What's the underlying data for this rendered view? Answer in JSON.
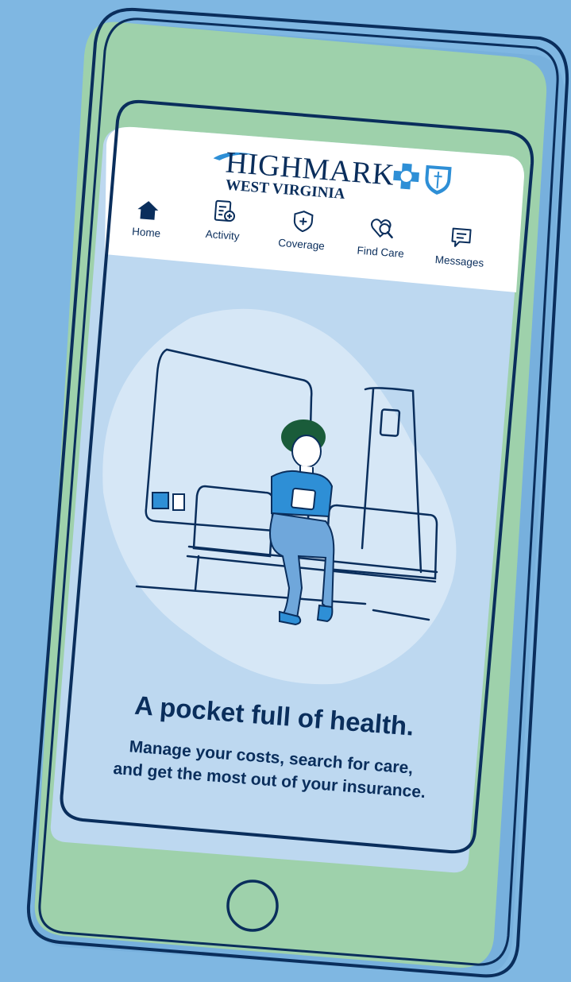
{
  "brand": {
    "name": "HIGHMARK",
    "region": "WEST VIRGINIA",
    "logo_icon": "blue-cross-blue-shield-logo"
  },
  "nav": {
    "tabs": [
      {
        "label": "Home",
        "icon": "house-icon",
        "active": true
      },
      {
        "label": "Activity",
        "icon": "clipboard-plus-icon"
      },
      {
        "label": "Coverage",
        "icon": "shield-plus-icon"
      },
      {
        "label": "Find Care",
        "icon": "heart-search-icon"
      },
      {
        "label": "Messages",
        "icon": "message-bubble-icon"
      }
    ]
  },
  "hero": {
    "headline": "A pocket full of health.",
    "subtext_line1": "Manage your costs, search for care,",
    "subtext_line2": "and get the most out of your insurance."
  },
  "colors": {
    "background": "#7fb7e2",
    "phone_green": "#9ed1ab",
    "outline": "#0a2e5c",
    "screen_blue": "#bdd8f0",
    "accent_blue": "#2e8fd6"
  }
}
